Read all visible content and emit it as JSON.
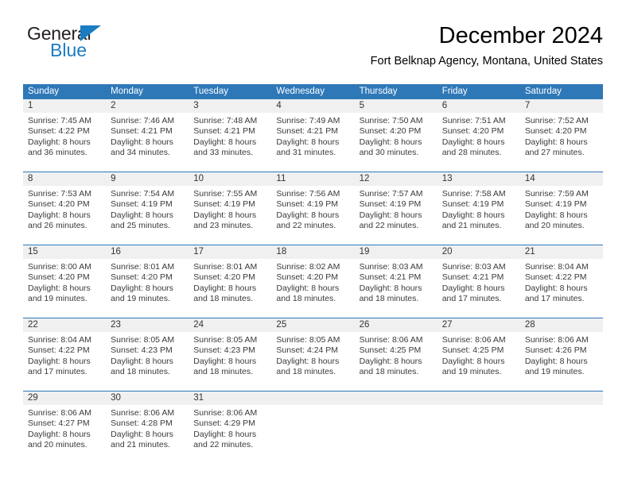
{
  "brand": {
    "line1": "General",
    "line2": "Blue",
    "triangle_color": "#1b7cc1",
    "text_color": "#231f20"
  },
  "header": {
    "title": "December 2024",
    "subtitle": "Fort Belknap Agency, Montana, United States"
  },
  "colors": {
    "header_blue": "#2e78b8",
    "daynum_bg": "#f0f0f0",
    "separator": "#2e78b8",
    "body_text": "#3a3a3a"
  },
  "calendar": {
    "weekday_headers": [
      "Sunday",
      "Monday",
      "Tuesday",
      "Wednesday",
      "Thursday",
      "Friday",
      "Saturday"
    ],
    "weeks": [
      [
        {
          "day": "1",
          "sunrise": "Sunrise: 7:45 AM",
          "sunset": "Sunset: 4:22 PM",
          "daylight1": "Daylight: 8 hours",
          "daylight2": "and 36 minutes."
        },
        {
          "day": "2",
          "sunrise": "Sunrise: 7:46 AM",
          "sunset": "Sunset: 4:21 PM",
          "daylight1": "Daylight: 8 hours",
          "daylight2": "and 34 minutes."
        },
        {
          "day": "3",
          "sunrise": "Sunrise: 7:48 AM",
          "sunset": "Sunset: 4:21 PM",
          "daylight1": "Daylight: 8 hours",
          "daylight2": "and 33 minutes."
        },
        {
          "day": "4",
          "sunrise": "Sunrise: 7:49 AM",
          "sunset": "Sunset: 4:21 PM",
          "daylight1": "Daylight: 8 hours",
          "daylight2": "and 31 minutes."
        },
        {
          "day": "5",
          "sunrise": "Sunrise: 7:50 AM",
          "sunset": "Sunset: 4:20 PM",
          "daylight1": "Daylight: 8 hours",
          "daylight2": "and 30 minutes."
        },
        {
          "day": "6",
          "sunrise": "Sunrise: 7:51 AM",
          "sunset": "Sunset: 4:20 PM",
          "daylight1": "Daylight: 8 hours",
          "daylight2": "and 28 minutes."
        },
        {
          "day": "7",
          "sunrise": "Sunrise: 7:52 AM",
          "sunset": "Sunset: 4:20 PM",
          "daylight1": "Daylight: 8 hours",
          "daylight2": "and 27 minutes."
        }
      ],
      [
        {
          "day": "8",
          "sunrise": "Sunrise: 7:53 AM",
          "sunset": "Sunset: 4:20 PM",
          "daylight1": "Daylight: 8 hours",
          "daylight2": "and 26 minutes."
        },
        {
          "day": "9",
          "sunrise": "Sunrise: 7:54 AM",
          "sunset": "Sunset: 4:19 PM",
          "daylight1": "Daylight: 8 hours",
          "daylight2": "and 25 minutes."
        },
        {
          "day": "10",
          "sunrise": "Sunrise: 7:55 AM",
          "sunset": "Sunset: 4:19 PM",
          "daylight1": "Daylight: 8 hours",
          "daylight2": "and 23 minutes."
        },
        {
          "day": "11",
          "sunrise": "Sunrise: 7:56 AM",
          "sunset": "Sunset: 4:19 PM",
          "daylight1": "Daylight: 8 hours",
          "daylight2": "and 22 minutes."
        },
        {
          "day": "12",
          "sunrise": "Sunrise: 7:57 AM",
          "sunset": "Sunset: 4:19 PM",
          "daylight1": "Daylight: 8 hours",
          "daylight2": "and 22 minutes."
        },
        {
          "day": "13",
          "sunrise": "Sunrise: 7:58 AM",
          "sunset": "Sunset: 4:19 PM",
          "daylight1": "Daylight: 8 hours",
          "daylight2": "and 21 minutes."
        },
        {
          "day": "14",
          "sunrise": "Sunrise: 7:59 AM",
          "sunset": "Sunset: 4:19 PM",
          "daylight1": "Daylight: 8 hours",
          "daylight2": "and 20 minutes."
        }
      ],
      [
        {
          "day": "15",
          "sunrise": "Sunrise: 8:00 AM",
          "sunset": "Sunset: 4:20 PM",
          "daylight1": "Daylight: 8 hours",
          "daylight2": "and 19 minutes."
        },
        {
          "day": "16",
          "sunrise": "Sunrise: 8:01 AM",
          "sunset": "Sunset: 4:20 PM",
          "daylight1": "Daylight: 8 hours",
          "daylight2": "and 19 minutes."
        },
        {
          "day": "17",
          "sunrise": "Sunrise: 8:01 AM",
          "sunset": "Sunset: 4:20 PM",
          "daylight1": "Daylight: 8 hours",
          "daylight2": "and 18 minutes."
        },
        {
          "day": "18",
          "sunrise": "Sunrise: 8:02 AM",
          "sunset": "Sunset: 4:20 PM",
          "daylight1": "Daylight: 8 hours",
          "daylight2": "and 18 minutes."
        },
        {
          "day": "19",
          "sunrise": "Sunrise: 8:03 AM",
          "sunset": "Sunset: 4:21 PM",
          "daylight1": "Daylight: 8 hours",
          "daylight2": "and 18 minutes."
        },
        {
          "day": "20",
          "sunrise": "Sunrise: 8:03 AM",
          "sunset": "Sunset: 4:21 PM",
          "daylight1": "Daylight: 8 hours",
          "daylight2": "and 17 minutes."
        },
        {
          "day": "21",
          "sunrise": "Sunrise: 8:04 AM",
          "sunset": "Sunset: 4:22 PM",
          "daylight1": "Daylight: 8 hours",
          "daylight2": "and 17 minutes."
        }
      ],
      [
        {
          "day": "22",
          "sunrise": "Sunrise: 8:04 AM",
          "sunset": "Sunset: 4:22 PM",
          "daylight1": "Daylight: 8 hours",
          "daylight2": "and 17 minutes."
        },
        {
          "day": "23",
          "sunrise": "Sunrise: 8:05 AM",
          "sunset": "Sunset: 4:23 PM",
          "daylight1": "Daylight: 8 hours",
          "daylight2": "and 18 minutes."
        },
        {
          "day": "24",
          "sunrise": "Sunrise: 8:05 AM",
          "sunset": "Sunset: 4:23 PM",
          "daylight1": "Daylight: 8 hours",
          "daylight2": "and 18 minutes."
        },
        {
          "day": "25",
          "sunrise": "Sunrise: 8:05 AM",
          "sunset": "Sunset: 4:24 PM",
          "daylight1": "Daylight: 8 hours",
          "daylight2": "and 18 minutes."
        },
        {
          "day": "26",
          "sunrise": "Sunrise: 8:06 AM",
          "sunset": "Sunset: 4:25 PM",
          "daylight1": "Daylight: 8 hours",
          "daylight2": "and 18 minutes."
        },
        {
          "day": "27",
          "sunrise": "Sunrise: 8:06 AM",
          "sunset": "Sunset: 4:25 PM",
          "daylight1": "Daylight: 8 hours",
          "daylight2": "and 19 minutes."
        },
        {
          "day": "28",
          "sunrise": "Sunrise: 8:06 AM",
          "sunset": "Sunset: 4:26 PM",
          "daylight1": "Daylight: 8 hours",
          "daylight2": "and 19 minutes."
        }
      ],
      [
        {
          "day": "29",
          "sunrise": "Sunrise: 8:06 AM",
          "sunset": "Sunset: 4:27 PM",
          "daylight1": "Daylight: 8 hours",
          "daylight2": "and 20 minutes."
        },
        {
          "day": "30",
          "sunrise": "Sunrise: 8:06 AM",
          "sunset": "Sunset: 4:28 PM",
          "daylight1": "Daylight: 8 hours",
          "daylight2": "and 21 minutes."
        },
        {
          "day": "31",
          "sunrise": "Sunrise: 8:06 AM",
          "sunset": "Sunset: 4:29 PM",
          "daylight1": "Daylight: 8 hours",
          "daylight2": "and 22 minutes."
        },
        {
          "day": "",
          "sunrise": "",
          "sunset": "",
          "daylight1": "",
          "daylight2": ""
        },
        {
          "day": "",
          "sunrise": "",
          "sunset": "",
          "daylight1": "",
          "daylight2": ""
        },
        {
          "day": "",
          "sunrise": "",
          "sunset": "",
          "daylight1": "",
          "daylight2": ""
        },
        {
          "day": "",
          "sunrise": "",
          "sunset": "",
          "daylight1": "",
          "daylight2": ""
        }
      ]
    ]
  }
}
